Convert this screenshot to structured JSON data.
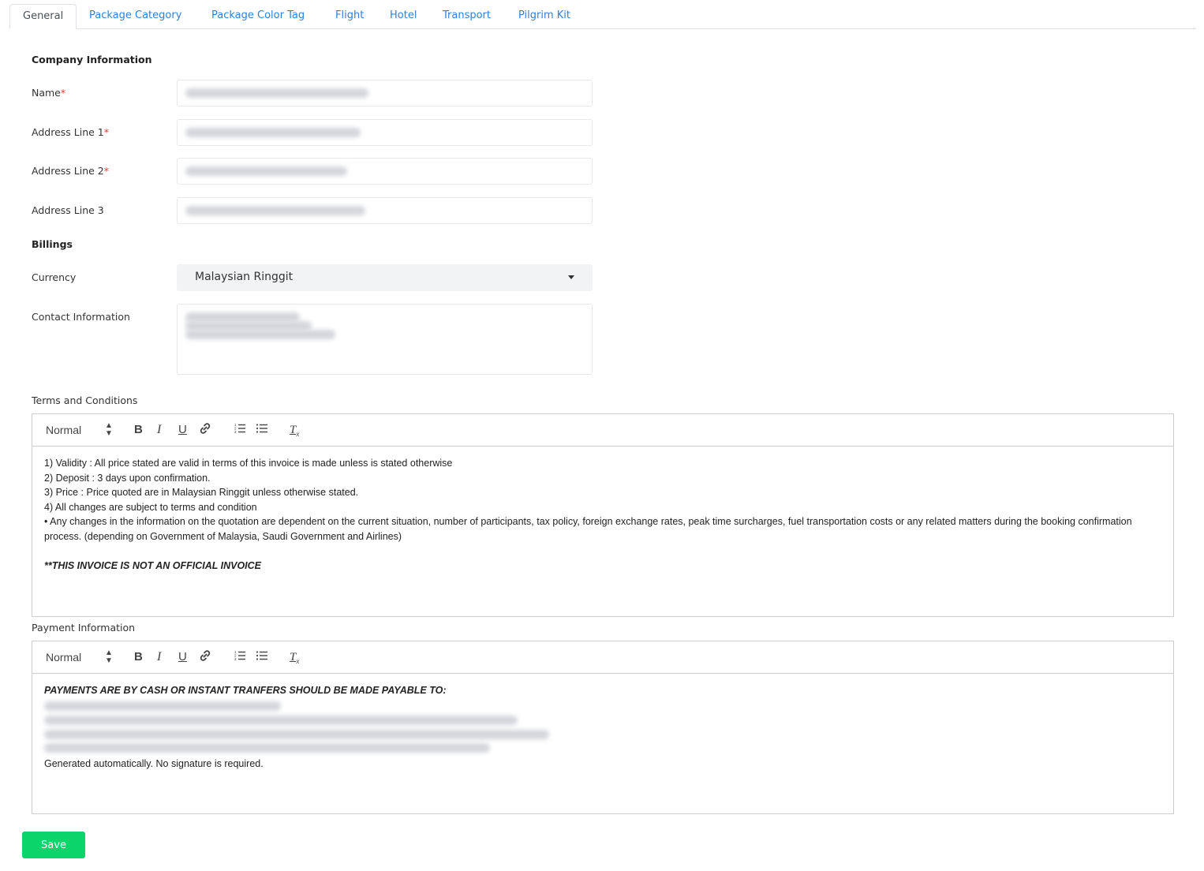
{
  "tabs": [
    "General",
    "Package Category",
    "Package Color Tag",
    "Flight",
    "Hotel",
    "Transport",
    "Pilgrim Kit"
  ],
  "company": {
    "section_title": "Company Information",
    "name_label": "Name",
    "address1_label": "Address Line 1",
    "address2_label": "Address Line 2",
    "address3_label": "Address Line 3",
    "required_mark": "*"
  },
  "billings": {
    "section_title": "Billings",
    "currency_label": "Currency",
    "currency_value": "Malaysian Ringgit",
    "contact_label": "Contact Information"
  },
  "terms": {
    "label": "Terms and Conditions",
    "format": "Normal",
    "lines": [
      "1) Validity : All price stated are valid in terms of this invoice is made unless is stated otherwise",
      "2) Deposit : 3 days upon confirmation.",
      "3) Price : Price quoted are in Malaysian Ringgit unless otherwise stated.",
      "4) All changes are subject to terms and condition",
      "• Any changes in the information on the quotation are dependent on the current situation, number of participants, tax policy, foreign exchange rates, peak time surcharges, fuel transportation costs or any related matters during the booking confirmation process. (depending on Government of Malaysia, Saudi Government and Airlines)"
    ],
    "note": "**THIS INVOICE IS NOT AN OFFICIAL INVOICE"
  },
  "payment": {
    "label": "Payment Information",
    "format": "Normal",
    "heading": "PAYMENTS ARE BY CASH OR INSTANT TRANFERS SHOULD BE MADE PAYABLE TO:",
    "footer": "Generated automatically. No signature is required."
  },
  "save_label": "Save",
  "colors": {
    "link": "#2f80d9",
    "save": "#0bd46a",
    "required": "#e53935"
  }
}
